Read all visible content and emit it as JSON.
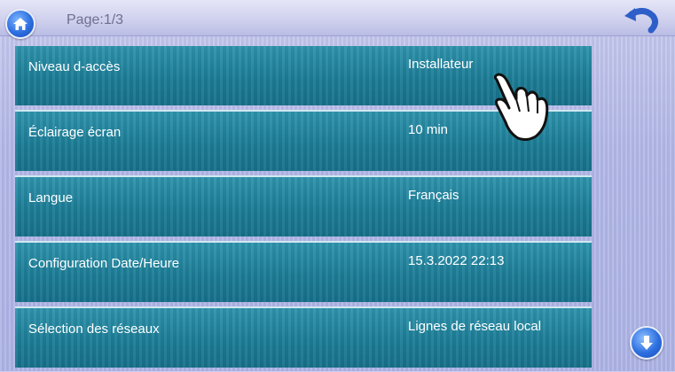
{
  "header": {
    "page_label": "Page:1/3",
    "home_icon": "home-icon",
    "back_icon": "undo-arrow-icon"
  },
  "settings": [
    {
      "label": "Niveau d-accès",
      "value": "Installateur"
    },
    {
      "label": "Éclairage écran",
      "value": "10 min"
    },
    {
      "label": "Langue",
      "value": "Français"
    },
    {
      "label": "Configuration Date/Heure",
      "value": "15.3.2022 22:13"
    },
    {
      "label": "Sélection des réseaux",
      "value": "Lignes de réseau local"
    }
  ],
  "footer": {
    "scroll_icon": "arrow-down-icon"
  },
  "overlay": {
    "pointer_icon": "hand-pointer-icon"
  },
  "colors": {
    "row_bg": "#1c7d96",
    "background": "#b3b8e8",
    "button_blue": "#2d6fe0"
  }
}
